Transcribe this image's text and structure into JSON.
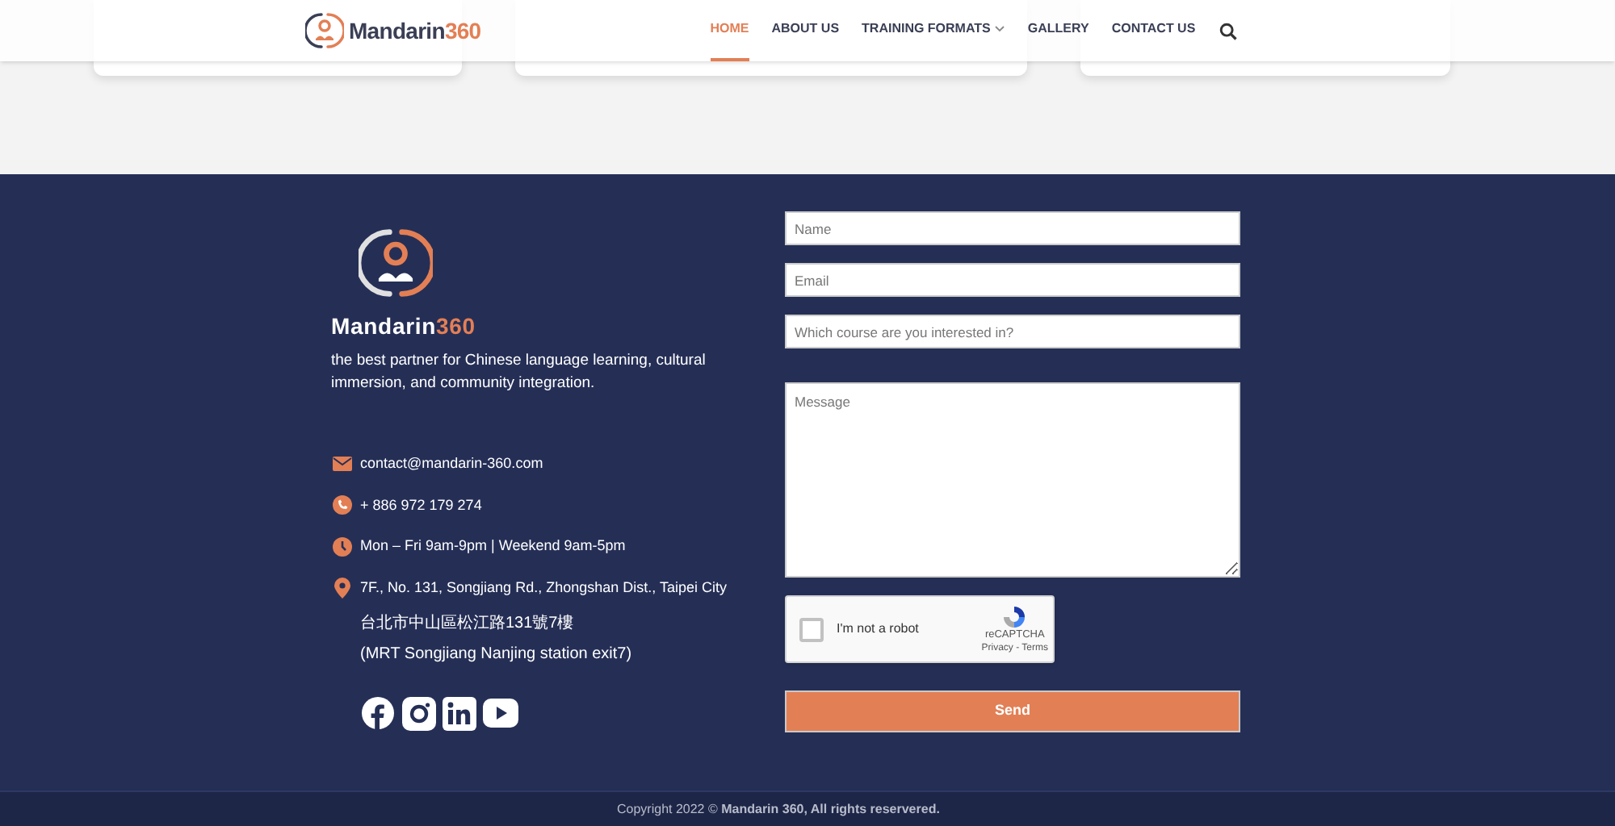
{
  "header": {
    "logo": {
      "name": "Mandarin",
      "number": "360"
    },
    "nav": [
      {
        "label": "HOME",
        "selected": true,
        "has_dropdown": false
      },
      {
        "label": "ABOUT US",
        "selected": false,
        "has_dropdown": false
      },
      {
        "label": "TRAINING FORMATS",
        "selected": false,
        "has_dropdown": true
      },
      {
        "label": "GALLERY",
        "selected": false,
        "has_dropdown": false
      },
      {
        "label": "CONTACT US",
        "selected": false,
        "has_dropdown": false
      }
    ]
  },
  "footer": {
    "logo": {
      "name": "Mandarin",
      "number": "360"
    },
    "tagline": "the best partner for Chinese language learning, cultural immersion, and community integration.",
    "contacts": [
      {
        "kind": "email",
        "text": "contact@mandarin-360.com"
      },
      {
        "kind": "phone",
        "text": "+ 886 972 179 274"
      },
      {
        "kind": "hours",
        "text": "Mon – Fri 9am-9pm | Weekend 9am-5pm"
      },
      {
        "kind": "address",
        "text": "7F., No. 131, Songjiang Rd., Zhongshan Dist., Taipei City"
      }
    ],
    "address_lines": [
      "台北市中山區松江路131號7樓",
      "(MRT Songjiang Nanjing station exit7)"
    ],
    "form": {
      "fields": [
        {
          "kind": "input",
          "placeholder": "Name"
        },
        {
          "kind": "input",
          "placeholder": "Email"
        },
        {
          "kind": "input",
          "placeholder": "Which course are you interested in?"
        },
        {
          "kind": "textarea",
          "placeholder": "Message"
        }
      ],
      "captcha": {
        "label": "I'm not a robot",
        "checked": false,
        "brand": "reCAPTCHA",
        "links": "Privacy - Terms"
      },
      "submit": "Send"
    },
    "copyright": "Copyright 2022 © **Mandarin 360, All rights reservered.**"
  }
}
